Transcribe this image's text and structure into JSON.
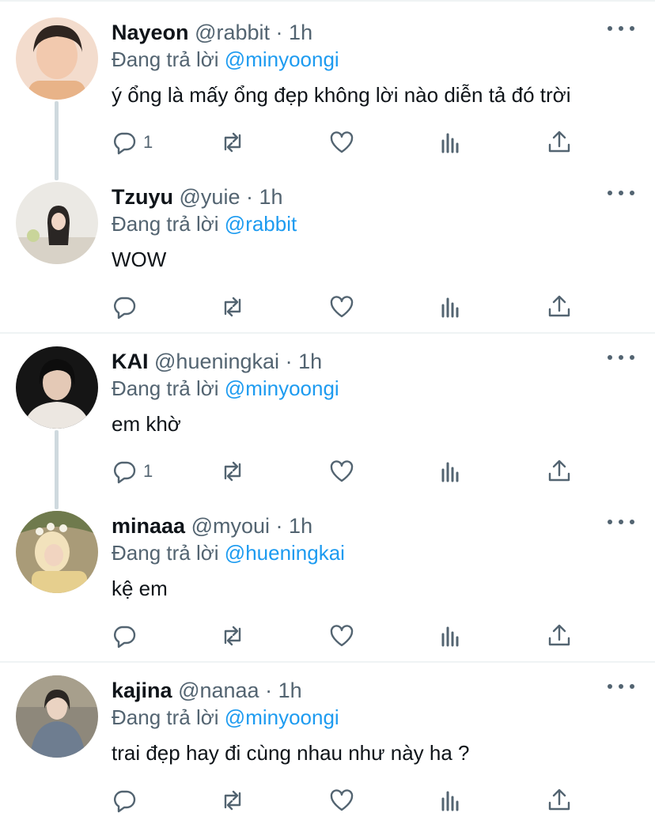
{
  "replying_label": "Đang trả lời",
  "tweets": [
    {
      "name": "Nayeon",
      "handle": "@rabbit",
      "dot": "·",
      "time": "1h",
      "reply_to": "@minyoongi",
      "text": "ý ổng là mấy ổng đẹp không lời nào diễn tả đó trời",
      "reply_count": "1",
      "avatar_colors": [
        "#f2d7c6",
        "#e8b79a",
        "#3a2a22"
      ]
    },
    {
      "name": "Tzuyu",
      "handle": "@yuie",
      "dot": "·",
      "time": "1h",
      "reply_to": "@rabbit",
      "text": "WOW",
      "reply_count": "",
      "avatar_colors": [
        "#e9e7e2",
        "#cfc9bf",
        "#2a2624"
      ]
    },
    {
      "name": "KAI",
      "handle": "@hueningkai",
      "dot": "·",
      "time": "1h",
      "reply_to": "@minyoongi",
      "text": "em khờ",
      "reply_count": "1",
      "avatar_colors": [
        "#1b1b1b",
        "#e9e4df",
        "#111111"
      ]
    },
    {
      "name": "minaaa",
      "handle": "@myoui",
      "dot": "·",
      "time": "1h",
      "reply_to": "@hueningkai",
      "text": "kệ em",
      "reply_count": "",
      "avatar_colors": [
        "#c8b88a",
        "#f1e2b5",
        "#7b6a45"
      ]
    },
    {
      "name": "kajina",
      "handle": "@nanaa",
      "dot": "·",
      "time": "1h",
      "reply_to": "@minyoongi",
      "text": "trai đẹp hay đi cùng nhau như này ha ?",
      "reply_count": "",
      "avatar_colors": [
        "#8f8a7e",
        "#6f7b8a",
        "#2d2a27"
      ]
    }
  ],
  "icons": {
    "reply": "reply-icon",
    "retweet": "retweet-icon",
    "like": "like-icon",
    "analytics": "analytics-icon",
    "share": "share-icon",
    "more": "more-icon"
  },
  "colors": {
    "link": "#1d9bf0",
    "muted": "#536471",
    "text": "#0f1419",
    "divider": "#eff3f4",
    "thread": "#cfd9de"
  }
}
